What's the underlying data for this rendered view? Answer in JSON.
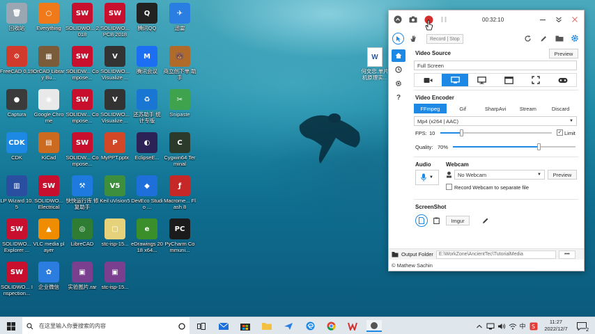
{
  "desktop": {
    "icons": [
      {
        "label": "回收站",
        "color": "#9aa7b3",
        "glyph": "🗑"
      },
      {
        "label": "Everything",
        "color": "#f07a1a",
        "glyph": "○"
      },
      {
        "label": "SOLIDWO... 2018",
        "color": "#c8102e",
        "glyph": "SW"
      },
      {
        "label": "SOLIDWO... PCB 2018",
        "color": "#c8102e",
        "glyph": "SW"
      },
      {
        "label": "腾讯QQ",
        "color": "#222222",
        "glyph": "Q"
      },
      {
        "label": "迅雷",
        "color": "#2a7de1",
        "glyph": "✈"
      },
      {
        "label": "FreeCAD 0.19",
        "color": "#d23b2b",
        "glyph": "⚙"
      },
      {
        "label": "OrCAD Library Bu...",
        "color": "#7a5b3a",
        "glyph": "▦"
      },
      {
        "label": "SOLIDW... Compose...",
        "color": "#c8102e",
        "glyph": "SW"
      },
      {
        "label": "SOLIDWO... Visualize ...",
        "color": "#333333",
        "glyph": "V"
      },
      {
        "label": "腾讯会议",
        "color": "#1c6ef2",
        "glyph": "M"
      },
      {
        "label": "商立创下单 助手",
        "color": "#b06a2a",
        "glyph": "🐻"
      },
      {
        "label": "Captura",
        "color": "#3b3b3b",
        "glyph": "●"
      },
      {
        "label": "Google Chrome",
        "color": "#e9e9e9",
        "glyph": "◉"
      },
      {
        "label": "SOLIDW... Compose...",
        "color": "#c8102e",
        "glyph": "SW"
      },
      {
        "label": "SOLIDWO... Visualize ...",
        "color": "#333333",
        "glyph": "V"
      },
      {
        "label": "还苏助手 统 计专版",
        "color": "#1976d2",
        "glyph": "♻"
      },
      {
        "label": "Snipaste",
        "color": "#3fa34d",
        "glyph": "✂"
      },
      {
        "label": "CDK",
        "color": "#1e88e5",
        "glyph": "CDK"
      },
      {
        "label": "KiCad",
        "color": "#cc6b1f",
        "glyph": "▤"
      },
      {
        "label": "SOLIDW... Compose...",
        "color": "#c8102e",
        "glyph": "SW"
      },
      {
        "label": "MyPPT.pptx",
        "color": "#d24726",
        "glyph": "P"
      },
      {
        "label": "EclipseE...",
        "color": "#2c2255",
        "glyph": "◐"
      },
      {
        "label": "Cygwin64 Terminal",
        "color": "#2b3a2b",
        "glyph": "C"
      },
      {
        "label": "LP Wizard 10.5",
        "color": "#2a4fa0",
        "glyph": "▥"
      },
      {
        "label": "SOLIDWO... Electrical",
        "color": "#c8102e",
        "glyph": "SW"
      },
      {
        "label": "快快运行库 修复助手",
        "color": "#1f7ae0",
        "glyph": "⚒"
      },
      {
        "label": "Keil uVision5",
        "color": "#3d8f3d",
        "glyph": "V5"
      },
      {
        "label": "DevEco Studio ...",
        "color": "#1e6fd9",
        "glyph": "◆"
      },
      {
        "label": "Macrome... Flash 8",
        "color": "#c62828",
        "glyph": "ƒ"
      },
      {
        "label": "SOLIDWO... Explorer ...",
        "color": "#c8102e",
        "glyph": "SW"
      },
      {
        "label": "VLC media player",
        "color": "#f08c00",
        "glyph": "▲"
      },
      {
        "label": "LibreCAD",
        "color": "#2e7d32",
        "glyph": "◎"
      },
      {
        "label": "stc-isp-15...",
        "color": "#e6d27a",
        "glyph": "▢"
      },
      {
        "label": "eDrawings 2018 x64...",
        "color": "#3a8f2a",
        "glyph": "e"
      },
      {
        "label": "PyCharm Communi...",
        "color": "#1b1b1b",
        "glyph": "PC"
      },
      {
        "label": "SOLIDWO... Inspection...",
        "color": "#c8102e",
        "glyph": "SW"
      },
      {
        "label": "企业微信",
        "color": "#2b7de0",
        "glyph": "✿"
      },
      {
        "label": "实验图片.rar",
        "color": "#7b3f8f",
        "glyph": "▣"
      },
      {
        "label": "stc-isp-15...",
        "color": "#7b3f8f",
        "glyph": "▣"
      }
    ],
    "file_icon": {
      "label": "何文忠.单片机原理实...",
      "color": "#2b579a",
      "glyph": "W"
    }
  },
  "app": {
    "timer": "00:32:10",
    "record_stop": "Record | Stop",
    "video_source": {
      "title": "Video Source",
      "preview_label": "Preview",
      "value": "Full Screen"
    },
    "video_encoder": {
      "title": "Video Encoder",
      "tabs": [
        "FFmpeg",
        "Gif",
        "SharpAvi",
        "Stream",
        "Discard"
      ],
      "active_tab": "FFmpeg",
      "codec": "Mp4 (x264 | AAC)",
      "fps_label": "FPS:",
      "fps_value": "10",
      "fps_fraction": 0.19,
      "limit_label": "Limit",
      "limit_checked": true,
      "quality_label": "Quality:",
      "quality_value": "70%",
      "quality_fraction": 0.7
    },
    "audio": {
      "title": "Audio"
    },
    "webcam": {
      "title": "Webcam",
      "value": "No Webcam",
      "preview_label": "Preview",
      "separate_label": "Record Webcam to separate file"
    },
    "screenshot": {
      "title": "ScreenShot",
      "imgur_label": "Imgur"
    },
    "output": {
      "label": "Output Folder",
      "path": "E:\\WorkZone\\AncientTec\\TutorialMedia",
      "more": "•••"
    },
    "credit": "© Mathew Sachin"
  },
  "taskbar": {
    "search_placeholder": "在这里输入你要搜索的内容",
    "time": "11:27",
    "date": "2022/12/7",
    "ime": "中",
    "notif_count": "2"
  },
  "colors": {
    "accent": "#1e88e5",
    "record": "#d32f2f"
  }
}
